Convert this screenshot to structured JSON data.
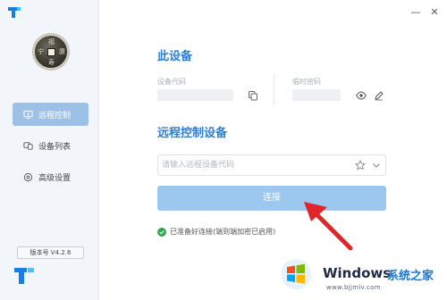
{
  "window": {
    "minimize_glyph": "—",
    "close_glyph": "✕"
  },
  "sidebar": {
    "avatar_chars": [
      "福",
      "寿",
      "康",
      "宁"
    ],
    "items": [
      {
        "label": "远程控制",
        "icon": "remote-screen-icon",
        "active": true
      },
      {
        "label": "设备列表",
        "icon": "device-list-icon",
        "active": false
      },
      {
        "label": "高级设置",
        "icon": "gear-icon",
        "active": false
      }
    ],
    "version": "版本号 V4.2.6"
  },
  "this_device": {
    "title": "此设备",
    "device_code_label": "设备代码",
    "temp_password_label": "临时密码"
  },
  "remote": {
    "title": "远程控制设备",
    "input_placeholder": "请输入远程设备代码",
    "connect_label": "连接"
  },
  "status": {
    "text": "已准备好连接(端到端加密已启用)"
  },
  "watermark": {
    "brand": "Windows",
    "brand_cn": "系统之家",
    "url": "www.bjjmlv.com"
  },
  "colors": {
    "accent": "#2b7fd6",
    "nav_active": "#9cc0e6",
    "button": "#9cc7ef",
    "status_ok": "#2fa84f",
    "arrow": "#e1262b"
  }
}
